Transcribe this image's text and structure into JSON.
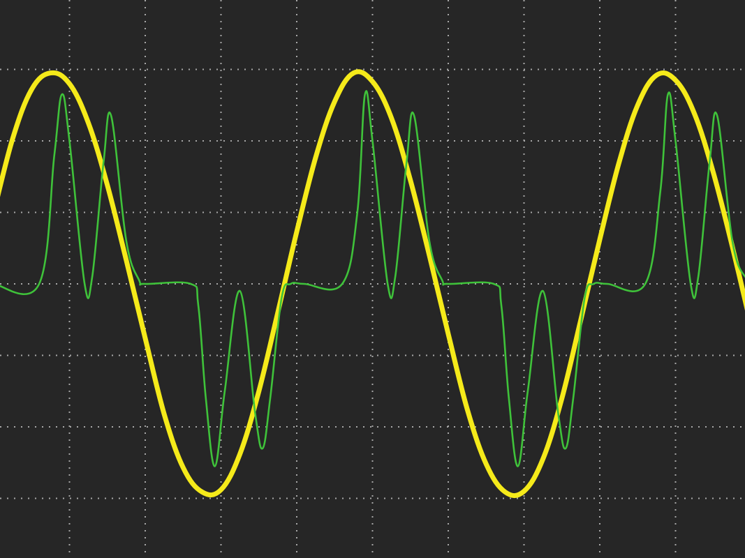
{
  "chart_data": {
    "type": "line",
    "title": "",
    "xlabel": "",
    "ylabel": "",
    "grid": true,
    "grid_divisions": {
      "x": 10,
      "y": 8
    },
    "xlim": [
      0,
      10
    ],
    "ylim": [
      -4,
      4
    ],
    "background_color": "#262626",
    "grid_color": "#a8a8a8",
    "series": [
      {
        "color": "#f5ea1a",
        "stroke": "thick",
        "x": [
          0.0,
          0.25,
          0.5,
          0.75,
          1.0,
          1.25,
          1.5,
          1.75,
          2.0,
          2.25,
          2.5,
          2.75,
          3.0,
          3.25,
          3.5,
          3.75,
          4.0,
          4.25,
          4.5,
          4.75,
          5.0,
          5.25,
          5.5,
          5.75,
          6.0,
          6.25,
          6.5,
          6.75,
          7.0,
          7.25,
          7.5,
          7.75,
          8.0,
          8.25,
          8.5,
          8.75,
          9.0,
          9.25,
          9.5,
          9.75,
          10.0
        ],
        "y": [
          1.0,
          2.03,
          2.72,
          2.95,
          2.8,
          2.25,
          1.38,
          0.33,
          -0.76,
          -1.82,
          -2.57,
          -2.91,
          -2.88,
          -2.38,
          -1.5,
          -0.4,
          0.73,
          1.77,
          2.55,
          2.95,
          2.83,
          2.32,
          1.45,
          0.4,
          -0.7,
          -1.75,
          -2.52,
          -2.91,
          -2.9,
          -2.45,
          -1.6,
          -0.5,
          0.62,
          1.68,
          2.5,
          2.92,
          2.85,
          2.38,
          1.55,
          0.52,
          -0.6
        ]
      },
      {
        "color": "#3fc23a",
        "stroke": "thin",
        "x": [
          0.0,
          0.6,
          0.8,
          0.9,
          1.0,
          1.2,
          1.3,
          1.45,
          1.55,
          1.75,
          1.92,
          2.0,
          2.6,
          2.7,
          2.8,
          2.92,
          3.05,
          3.25,
          3.45,
          3.55,
          3.65,
          3.8,
          3.92,
          4.1,
          4.6,
          4.8,
          4.9,
          5.0,
          5.2,
          5.3,
          5.45,
          5.55,
          5.75,
          5.92,
          6.0,
          6.6,
          6.7,
          6.8,
          6.92,
          7.05,
          7.25,
          7.45,
          7.55,
          7.65,
          7.8,
          7.92,
          8.1,
          8.6,
          8.8,
          8.9,
          9.0,
          9.2,
          9.3,
          9.45,
          9.55,
          9.75,
          9.92,
          10.0
        ],
        "y": [
          0.0,
          0.0,
          1.8,
          2.65,
          2.0,
          0.0,
          0.1,
          1.7,
          2.35,
          0.6,
          0.05,
          0.0,
          0.0,
          -0.3,
          -1.6,
          -2.55,
          -1.5,
          -0.1,
          -1.8,
          -2.3,
          -1.6,
          -0.2,
          0.0,
          0.0,
          0.0,
          1.0,
          2.65,
          2.0,
          0.0,
          0.1,
          1.7,
          2.35,
          0.6,
          0.05,
          0.0,
          0.0,
          -0.3,
          -1.6,
          -2.55,
          -1.5,
          -0.1,
          -1.8,
          -2.3,
          -1.6,
          -0.2,
          0.0,
          0.0,
          0.0,
          1.3,
          2.65,
          2.0,
          0.0,
          0.1,
          1.7,
          2.35,
          0.6,
          0.1,
          0.2
        ]
      }
    ]
  }
}
